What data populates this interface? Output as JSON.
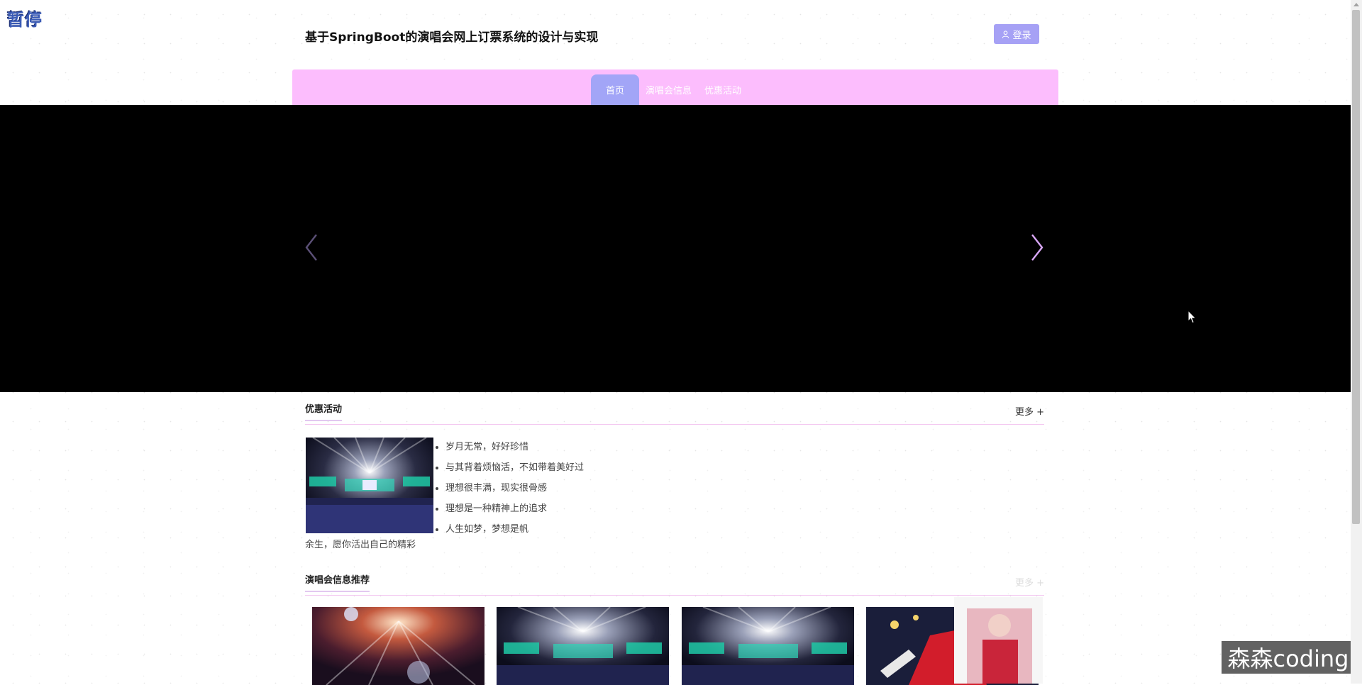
{
  "overlay": {
    "pause_label": "暂停",
    "watermark": "森森coding"
  },
  "header": {
    "title": "基于SpringBoot的演唱会网上订票系统的设计与实现",
    "login_label": "登录",
    "login_color": "#a6a1f5"
  },
  "nav": {
    "bg_color": "#fcbdfd",
    "active_color": "#a2a5f7",
    "items": [
      {
        "label": "首页",
        "active": true
      },
      {
        "label": "演唱会信息",
        "active": false
      },
      {
        "label": "优惠活动",
        "active": false
      }
    ]
  },
  "carousel": {
    "prev_icon": "chevron-left-icon",
    "next_icon": "chevron-right-icon"
  },
  "promotions": {
    "title": "优惠活动",
    "more_label": "更多 +",
    "items": [
      "岁月无常，好好珍惜",
      "与其背着烦恼活，不如带着美好过",
      "理想很丰满，现实很骨感",
      "理想是一种精神上的追求",
      "人生如梦，梦想是帆"
    ],
    "tail_text": "余生，愿你活出自己的精彩"
  },
  "concerts": {
    "title": "演唱会信息推荐",
    "more_label": "更多 +"
  }
}
